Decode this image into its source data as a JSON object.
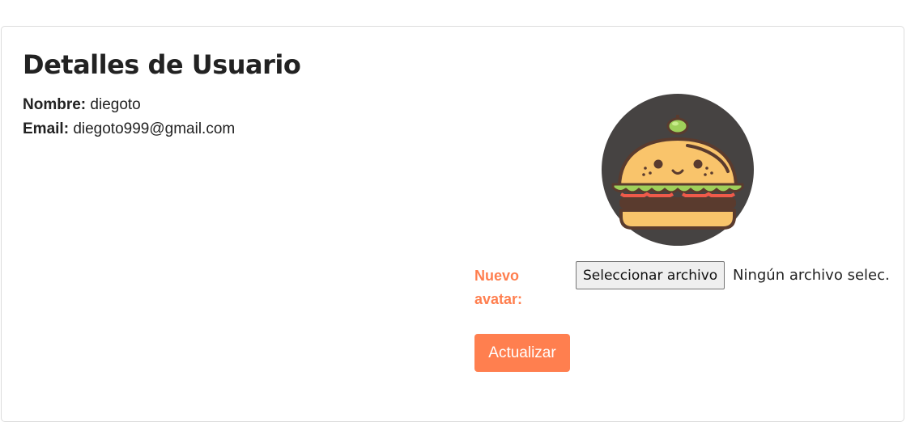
{
  "page": {
    "title": "Detalles de Usuario"
  },
  "user": {
    "name_label": "Nombre:",
    "name_value": "diegoto",
    "email_label": "Email:",
    "email_value": "diegoto999@gmail.com"
  },
  "avatar": {
    "icon": "hamburger-icon",
    "background_color": "#464342"
  },
  "upload": {
    "label": "Nuevo avatar:",
    "button_label": "Seleccionar archivo",
    "status": "Ningún archivo selec."
  },
  "actions": {
    "submit_label": "Actualizar"
  },
  "colors": {
    "accent": "#ff7f4f",
    "text": "#222222",
    "border": "#dcdcdc"
  }
}
